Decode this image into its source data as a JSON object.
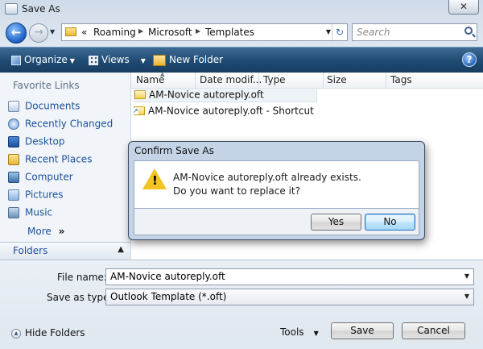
{
  "window": {
    "title": "Save As",
    "close_glyph": "✕"
  },
  "address": {
    "nav_back_glyph": "←",
    "nav_forward_glyph": "→",
    "chevrons": "«",
    "crumbs": [
      "Roaming",
      "Microsoft",
      "Templates"
    ],
    "search_placeholder": "Search"
  },
  "toolbar": {
    "organize": "Organize",
    "views": "Views",
    "new_folder": "New Folder",
    "help_glyph": "?"
  },
  "sidebar": {
    "favorite_links_heading": "Favorite Links",
    "links": [
      {
        "label": "Documents",
        "icon": "documents-icon"
      },
      {
        "label": "Recently Changed",
        "icon": "recently-changed-icon"
      },
      {
        "label": "Desktop",
        "icon": "desktop-icon"
      },
      {
        "label": "Recent Places",
        "icon": "recent-places-icon"
      },
      {
        "label": "Computer",
        "icon": "computer-icon"
      },
      {
        "label": "Pictures",
        "icon": "pictures-icon"
      },
      {
        "label": "Music",
        "icon": "music-icon"
      }
    ],
    "more": "More",
    "more_glyph": "»",
    "folders": "Folders"
  },
  "filelist": {
    "columns": [
      "Name",
      "Date modif...",
      "Type",
      "Size",
      "Tags"
    ],
    "files": [
      {
        "name": "AM-Novice autoreply.oft",
        "icon": "outlook-template-icon",
        "selected": true
      },
      {
        "name": "AM-Novice autoreply.oft - Shortcut",
        "icon": "shortcut-icon",
        "selected": false
      }
    ]
  },
  "form": {
    "file_name_label": "File name:",
    "file_name_value": "AM-Novice autoreply.oft",
    "save_as_type_label": "Save as type:",
    "save_as_type_value": "Outlook Template (*.oft)"
  },
  "footer": {
    "hide_folders": "Hide Folders",
    "tools": "Tools",
    "save": "Save",
    "cancel": "Cancel"
  },
  "dialog": {
    "title": "Confirm Save As",
    "message_line1": "AM-Novice autoreply.oft already exists.",
    "message_line2": "Do you want to replace it?",
    "warning_glyph": "!",
    "yes": "Yes",
    "no": "No"
  },
  "colors": {
    "toolbar": "#1f4a72",
    "link": "#1c4f9e",
    "warning": "#f2c322"
  }
}
